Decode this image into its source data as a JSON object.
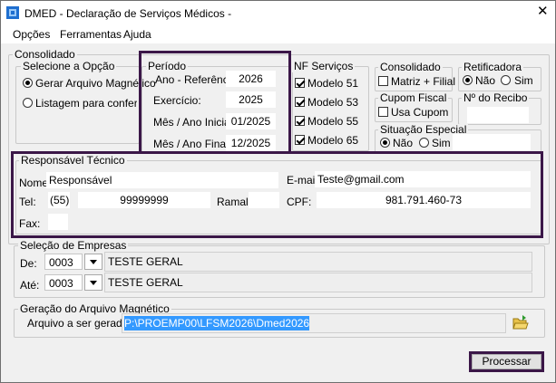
{
  "window": {
    "title": "DMED - Declaração de Serviços Médicos -"
  },
  "menu": [
    "Opções",
    "Ferramentas",
    "Ajuda"
  ],
  "consolidado_outer": "Consolidado",
  "selecione": {
    "title": "Selecione a Opção",
    "options": [
      "Gerar Arquivo Magnético",
      "Listagem para conferência"
    ],
    "selected": 0
  },
  "periodo": {
    "title": "Período",
    "ano_ref_label": "Ano - Referência:",
    "ano_ref": "2026",
    "exercicio_label": "Exercício:",
    "exercicio": "2025",
    "inicial_label": "Mês / Ano Inicial:",
    "inicial": "01/2025",
    "final_label": "Mês / Ano Final:",
    "final": "12/2025"
  },
  "nf": {
    "title": "NF Serviços",
    "items": [
      "Modelo 51",
      "Modelo 53",
      "Modelo 55",
      "Modelo 65"
    ]
  },
  "consolidado_box": {
    "title": "Consolidado",
    "label": "Matriz + Filial"
  },
  "cupom": {
    "title": "Cupom Fiscal",
    "label": "Usa Cupom"
  },
  "retificadora": {
    "title": "Retificadora",
    "nao": "Não",
    "sim": "Sim"
  },
  "recibo": {
    "title": "Nº do Recibo",
    "value": ""
  },
  "situacao": {
    "title": "Situação Especial",
    "nao": "Não",
    "sim": "Sim",
    "value": ""
  },
  "responsavel": {
    "title": "Responsável Técnico",
    "nome_label": "Nome:",
    "nome": "Responsável",
    "email_label": "E-mail:",
    "email": "Teste@gmail.com",
    "tel_label": "Tel:",
    "ddd": "(55)",
    "tel": "99999999",
    "ramal_label": "Ramal:",
    "ramal": "",
    "cpf_label": "CPF:",
    "cpf": "981.791.460-73",
    "fax_label": "Fax:",
    "fax": ""
  },
  "empresas": {
    "title": "Seleção de Empresas",
    "de_label": "De:",
    "de_code": "0003",
    "de_name": "TESTE GERAL",
    "ate_label": "Até:",
    "ate_code": "0003",
    "ate_name": "TESTE GERAL"
  },
  "geracao": {
    "title": "Geração do Arquivo Magnético",
    "label": "Arquivo a ser gerado:",
    "path": "P:\\PROEMP00\\LFSM2026\\Dmed2026"
  },
  "processar": "Processar",
  "colors": {
    "accent_border": "#3b1748",
    "selection": "#3399ff"
  }
}
